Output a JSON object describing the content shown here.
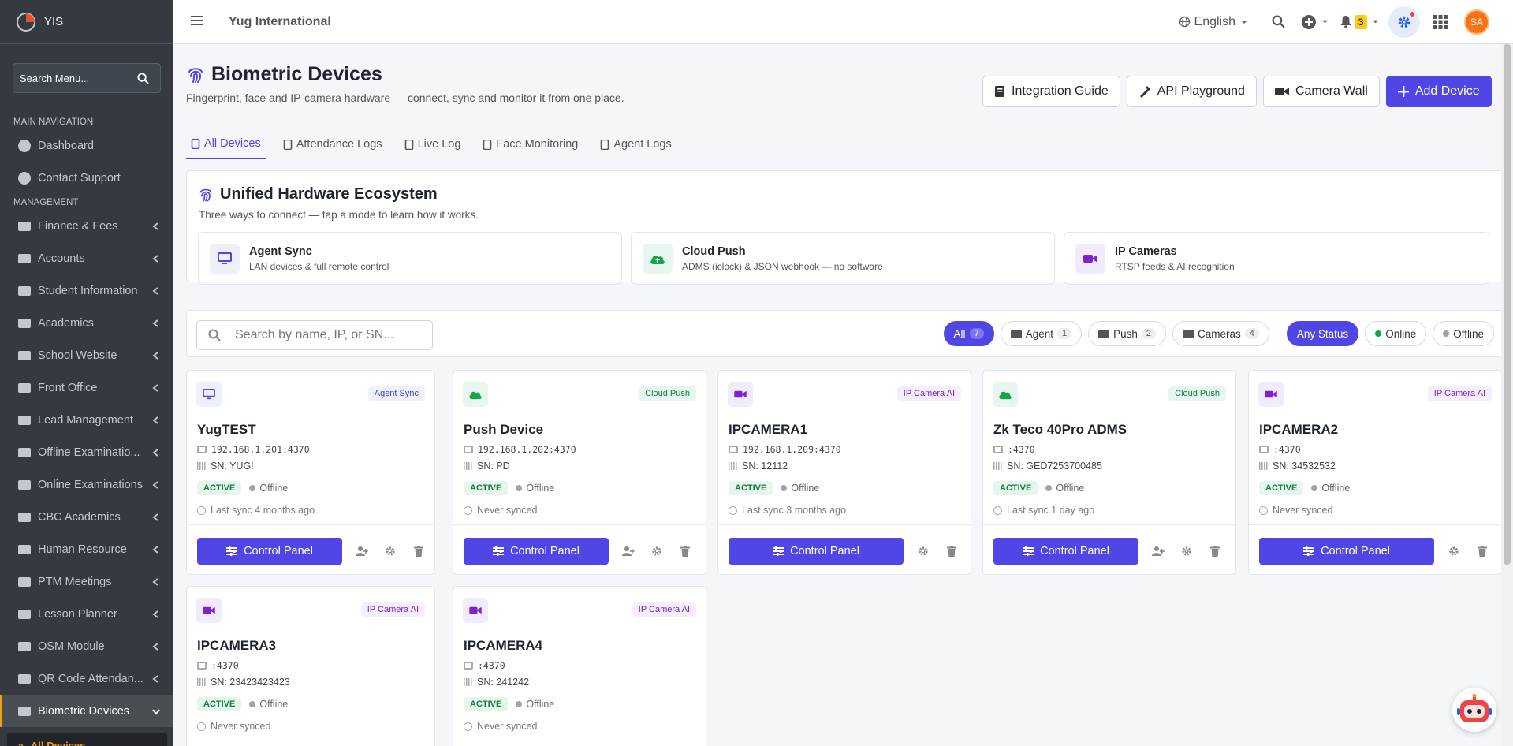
{
  "brand": {
    "name": "YIS"
  },
  "sidebar": {
    "search_placeholder": "Search Menu...",
    "main_header": "MAIN NAVIGATION",
    "main_items": [
      {
        "label": "Dashboard",
        "icon": "tachometer-icon"
      },
      {
        "label": "Contact Support",
        "icon": "support-icon"
      }
    ],
    "mgmt_header": "MANAGEMENT",
    "mgmt_items": [
      {
        "label": "Finance & Fees",
        "icon": "wallet-icon"
      },
      {
        "label": "Accounts",
        "icon": "calculator-icon"
      },
      {
        "label": "Student Information",
        "icon": "user-graduate-icon"
      },
      {
        "label": "Academics",
        "icon": "school-icon"
      },
      {
        "label": "School Website",
        "icon": "globe-icon"
      },
      {
        "label": "Front Office",
        "icon": "monitor-icon"
      },
      {
        "label": "Lead Management",
        "icon": "funnel-icon"
      },
      {
        "label": "Offline Examinatio...",
        "icon": "graduation-cap-icon"
      },
      {
        "label": "Online Examinations",
        "icon": "laptop-icon"
      },
      {
        "label": "CBC Academics",
        "icon": "users-icon"
      },
      {
        "label": "Human Resource",
        "icon": "user-group-icon"
      },
      {
        "label": "PTM Meetings",
        "icon": "meeting-icon"
      },
      {
        "label": "Lesson Planner",
        "icon": "book-icon"
      },
      {
        "label": "OSM Module",
        "icon": "check-circle-icon"
      },
      {
        "label": "QR Code Attendan...",
        "icon": "user-check-icon"
      },
      {
        "label": "Biometric Devices",
        "icon": "fingerprint-icon"
      }
    ],
    "sub_active": "All Devices"
  },
  "topbar": {
    "school_name": "Yug International",
    "language": "English",
    "notification_count": "3",
    "avatar_initials": "SA"
  },
  "page": {
    "title": "Biometric Devices",
    "subtitle": "Fingerprint, face and IP-camera hardware — connect, sync and monitor it from one place.",
    "buttons": {
      "integration": "Integration Guide",
      "api": "API Playground",
      "camera_wall": "Camera Wall",
      "add": "Add Device"
    },
    "tabs": [
      "All Devices",
      "Attendance Logs",
      "Live Log",
      "Face Monitoring",
      "Agent Logs"
    ]
  },
  "ecosystem": {
    "title": "Unified Hardware Ecosystem",
    "subtitle": "Three ways to connect — tap a mode to learn how it works.",
    "modes": [
      {
        "title": "Agent Sync",
        "desc": "LAN devices & full remote control"
      },
      {
        "title": "Cloud Push",
        "desc": "ADMS (iclock) & JSON webhook — no software"
      },
      {
        "title": "IP Cameras",
        "desc": "RTSP feeds & AI recognition"
      }
    ]
  },
  "filters": {
    "search_placeholder": "Search by name, IP, or SN...",
    "type_chips": [
      {
        "label": "All",
        "count": "7"
      },
      {
        "label": "Agent",
        "count": "1"
      },
      {
        "label": "Push",
        "count": "2"
      },
      {
        "label": "Cameras",
        "count": "4"
      }
    ],
    "status_chips": [
      "Any Status",
      "Online",
      "Offline"
    ]
  },
  "devices": [
    {
      "name": "YugTEST",
      "type": "Agent Sync",
      "ip": "192.168.1.201:4370",
      "sn": "SN: YUG!",
      "state": "ACTIVE",
      "conn": "Offline",
      "sync": "Last sync 4 months ago"
    },
    {
      "name": "Push Device",
      "type": "Cloud Push",
      "ip": "192.168.1.202:4370",
      "sn": "SN: PD",
      "state": "ACTIVE",
      "conn": "Offline",
      "sync": "Never synced"
    },
    {
      "name": "IPCAMERA1",
      "type": "IP Camera AI",
      "ip": "192.168.1.209:4370",
      "sn": "SN: 12112",
      "state": "ACTIVE",
      "conn": "Offline",
      "sync": "Last sync 3 months ago"
    },
    {
      "name": "Zk Teco 40Pro ADMS",
      "type": "Cloud Push",
      "ip": ":4370",
      "sn": "SN: GED7253700485",
      "state": "ACTIVE",
      "conn": "Offline",
      "sync": "Last sync 1 day ago"
    },
    {
      "name": "IPCAMERA2",
      "type": "IP Camera AI",
      "ip": ":4370",
      "sn": "SN: 34532532",
      "state": "ACTIVE",
      "conn": "Offline",
      "sync": "Never synced"
    },
    {
      "name": "IPCAMERA3",
      "type": "IP Camera AI",
      "ip": ":4370",
      "sn": "SN: 23423423423",
      "state": "ACTIVE",
      "conn": "Offline",
      "sync": "Never synced"
    },
    {
      "name": "IPCAMERA4",
      "type": "IP Camera AI",
      "ip": ":4370",
      "sn": "SN: 241242",
      "state": "ACTIVE",
      "conn": "Offline",
      "sync": "Never synced"
    }
  ],
  "control_panel_label": "Control Panel",
  "colors": {
    "primary": "#4f46e5",
    "sidebar": "#343a40",
    "accent": "#f59e0b",
    "success": "#15803d"
  }
}
